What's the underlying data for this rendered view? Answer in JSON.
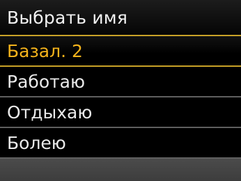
{
  "header": {
    "title": "Выбрать имя"
  },
  "menu": {
    "items": [
      {
        "label": "Базал. 2",
        "selected": true
      },
      {
        "label": "Работаю",
        "selected": false
      },
      {
        "label": "Отдыхаю",
        "selected": false
      },
      {
        "label": "Болею",
        "selected": false
      }
    ]
  },
  "colors": {
    "accent": "#f3b21b",
    "divider_gold": "#c9a227",
    "divider_gray": "#5f5f5f",
    "text": "#eaeaea",
    "background": "#000000",
    "footer": "#444444"
  }
}
